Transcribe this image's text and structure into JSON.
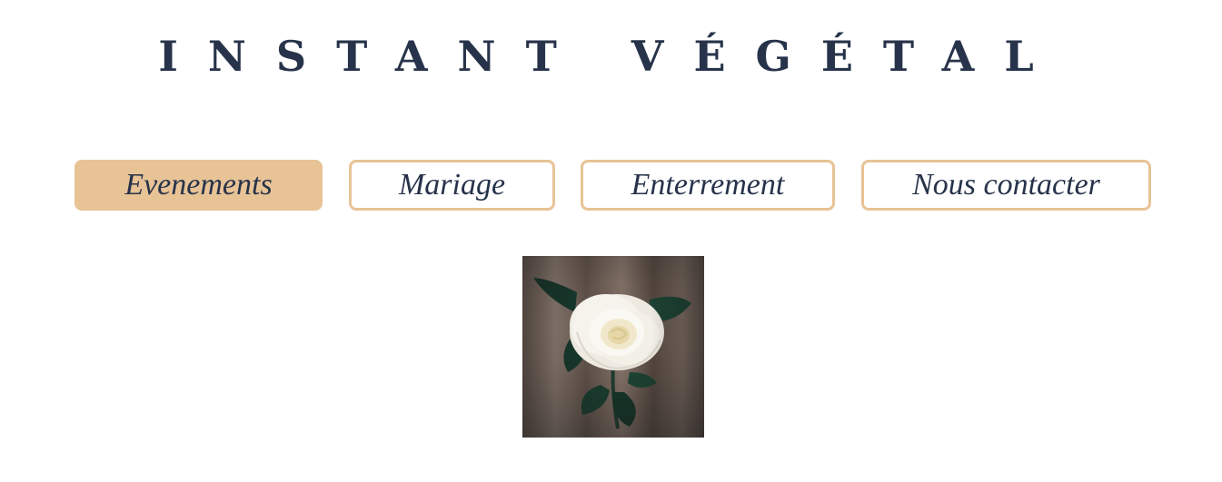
{
  "site": {
    "title": "INSTANT VÉGÉTAL"
  },
  "nav": {
    "items": [
      {
        "label": "Evenements",
        "active": true
      },
      {
        "label": "Mariage",
        "active": false
      },
      {
        "label": "Enterrement",
        "active": false
      },
      {
        "label": "Nous contacter",
        "active": false
      }
    ]
  },
  "colors": {
    "accent": "#e8c396",
    "text": "#27334a",
    "background": "#ffffff"
  },
  "image": {
    "subject": "white-rose-photo"
  }
}
